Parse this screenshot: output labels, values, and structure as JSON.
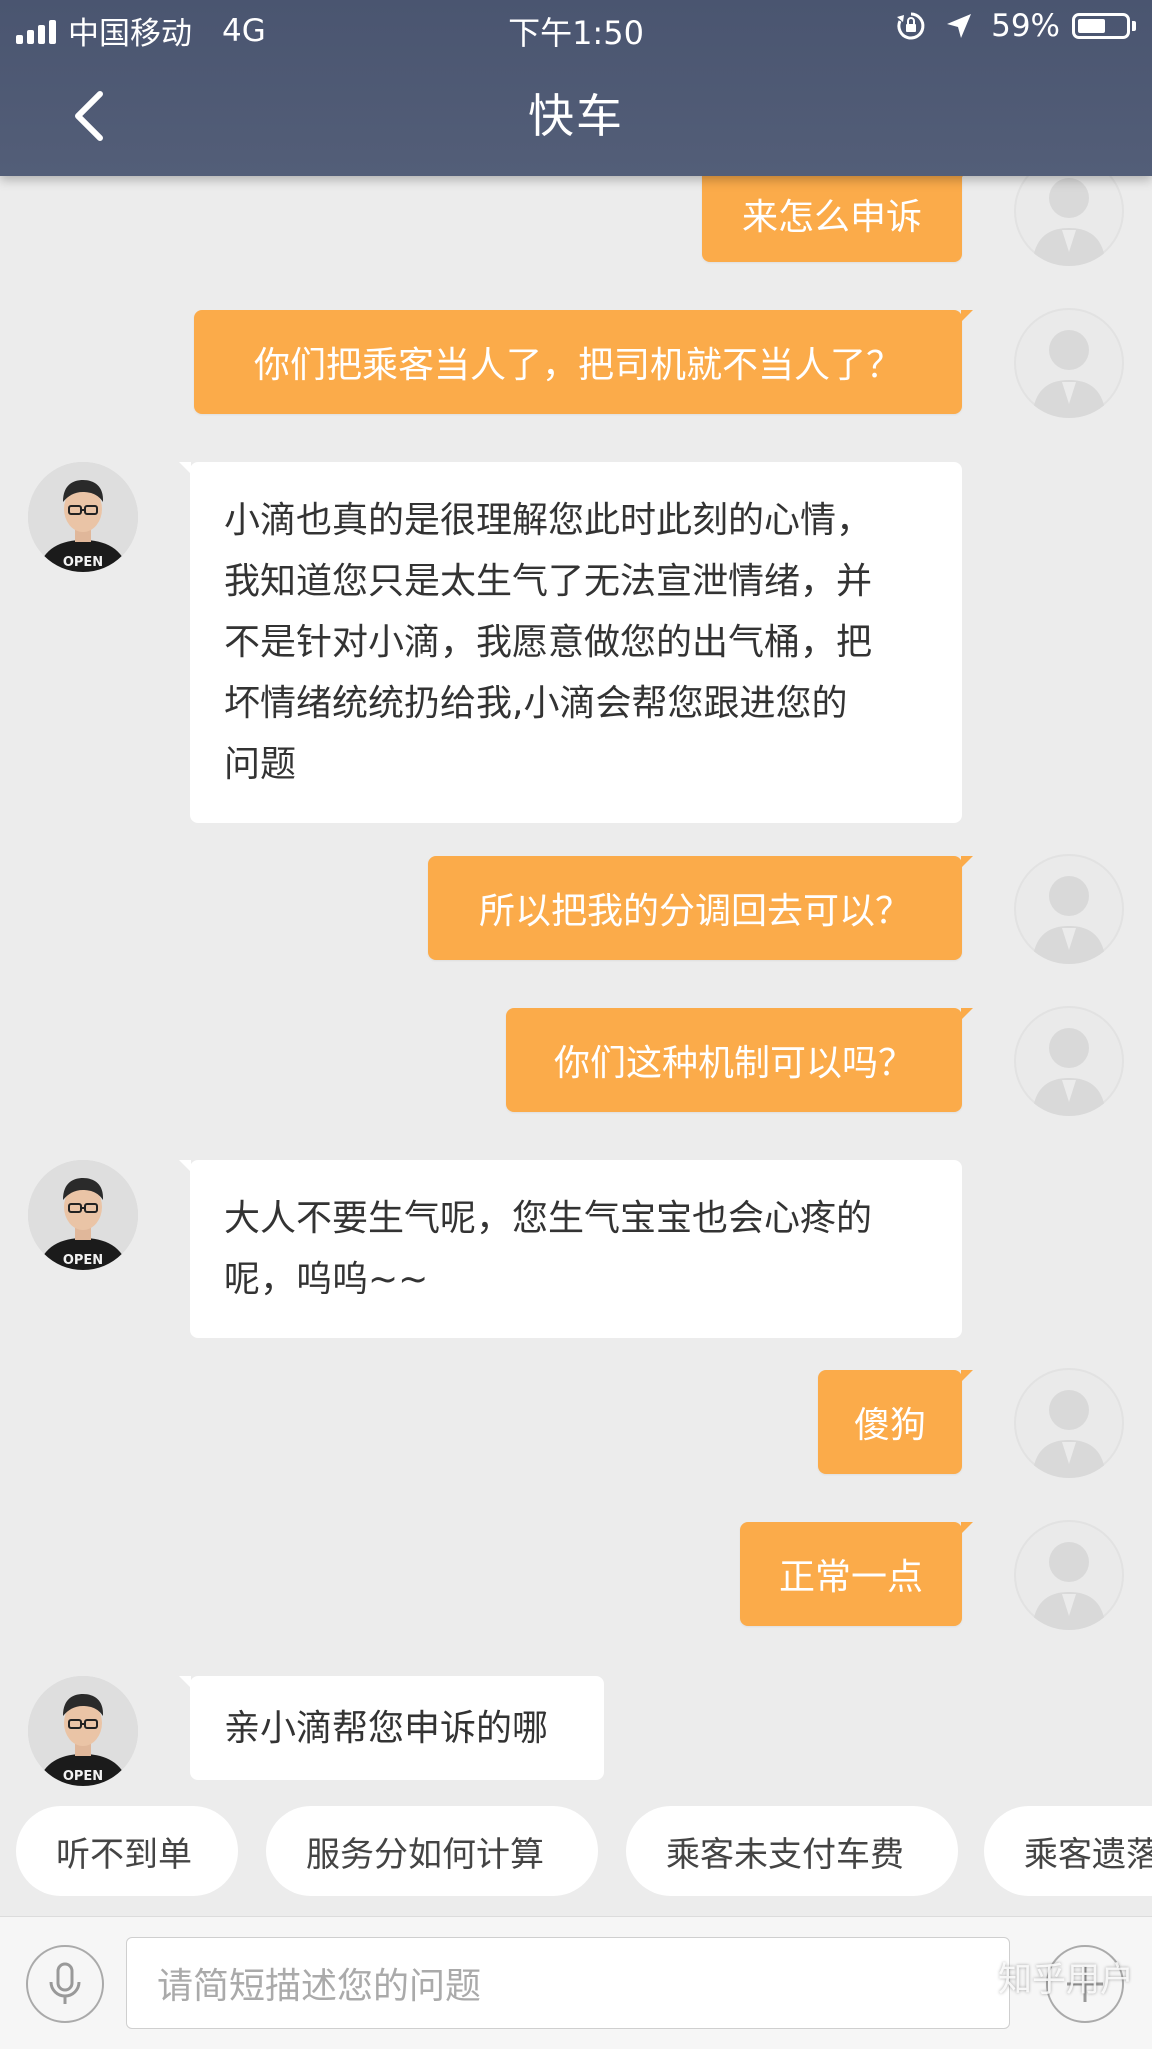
{
  "status_bar": {
    "carrier": "中国移动",
    "network": "4G",
    "time": "下午1:50",
    "battery_percent": "59%",
    "battery_level": 0.59,
    "icons": [
      "signal-icon",
      "orientation-lock-icon",
      "location-arrow-icon",
      "battery-icon"
    ]
  },
  "nav": {
    "title": "快车",
    "back_icon": "chevron-left-icon"
  },
  "messages": [
    {
      "sender": "user",
      "text": "来怎么申诉"
    },
    {
      "sender": "user",
      "text": "你们把乘客当人了，把司机就不当人了？"
    },
    {
      "sender": "agent",
      "lines": [
        "小滴也真的是很理解您此时此刻的心情，",
        "我知道您只是太生气了无法宣泄情绪，并",
        "不是针对小滴，我愿意做您的出气桶，把",
        "坏情绪统统扔给我,小滴会帮您跟进您的",
        "问题"
      ]
    },
    {
      "sender": "user",
      "text": "所以把我的分调回去可以？"
    },
    {
      "sender": "user",
      "text": "你们这种机制可以吗？"
    },
    {
      "sender": "agent",
      "lines": [
        "大人不要生气呢，您生气宝宝也会心疼的",
        "呢，呜呜~~"
      ]
    },
    {
      "sender": "user",
      "text": "傻狗"
    },
    {
      "sender": "user",
      "text": "正常一点"
    },
    {
      "sender": "agent",
      "lines": [
        "亲小滴帮您申诉的哪"
      ]
    }
  ],
  "agent_avatar": {
    "shirt_text": "OPEN"
  },
  "quick_replies": [
    "听不到单",
    "服务分如何计算",
    "乘客未支付车费",
    "乘客遗落"
  ],
  "input": {
    "placeholder": "请简短描述您的问题",
    "voice_icon": "microphone-icon",
    "plus_icon": "plus-icon"
  },
  "watermark": "知乎用户",
  "colors": {
    "header": "#4f5a74",
    "outgoing_bubble": "#fbab4a",
    "incoming_bubble": "#ffffff",
    "background": "#ececec"
  }
}
